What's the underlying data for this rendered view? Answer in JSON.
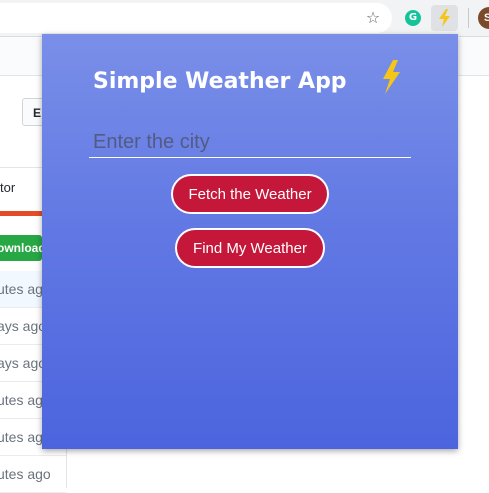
{
  "browser": {
    "star_glyph": "☆",
    "grammarly_glyph": "G",
    "profile_initial": "S"
  },
  "background_page": {
    "edit_button": "E",
    "contributor_text": "tor",
    "download_button": "ownload",
    "file_rows": [
      "utes ago",
      "ays ago",
      "ays ago",
      "utes ago",
      "utes ago",
      "utes ago"
    ]
  },
  "popup": {
    "title": "Simple Weather App",
    "city_input": {
      "placeholder": "Enter the city",
      "value": ""
    },
    "fetch_button": "Fetch the Weather",
    "locate_button": "Find My Weather"
  },
  "colors": {
    "popup_gradient_top": "#7a8fe8",
    "popup_gradient_bottom": "#4c64de",
    "button_background": "#c4173a",
    "bolt_yellow": "#f5c518",
    "download_green": "#28a745",
    "language_bar": "#e34c26"
  },
  "icons": {
    "title_icon": "lightning-bolt-icon",
    "extension_icon": "lightning-bolt-icon",
    "bookmark_icon": "star-icon",
    "grammarly_icon": "grammarly-icon"
  }
}
